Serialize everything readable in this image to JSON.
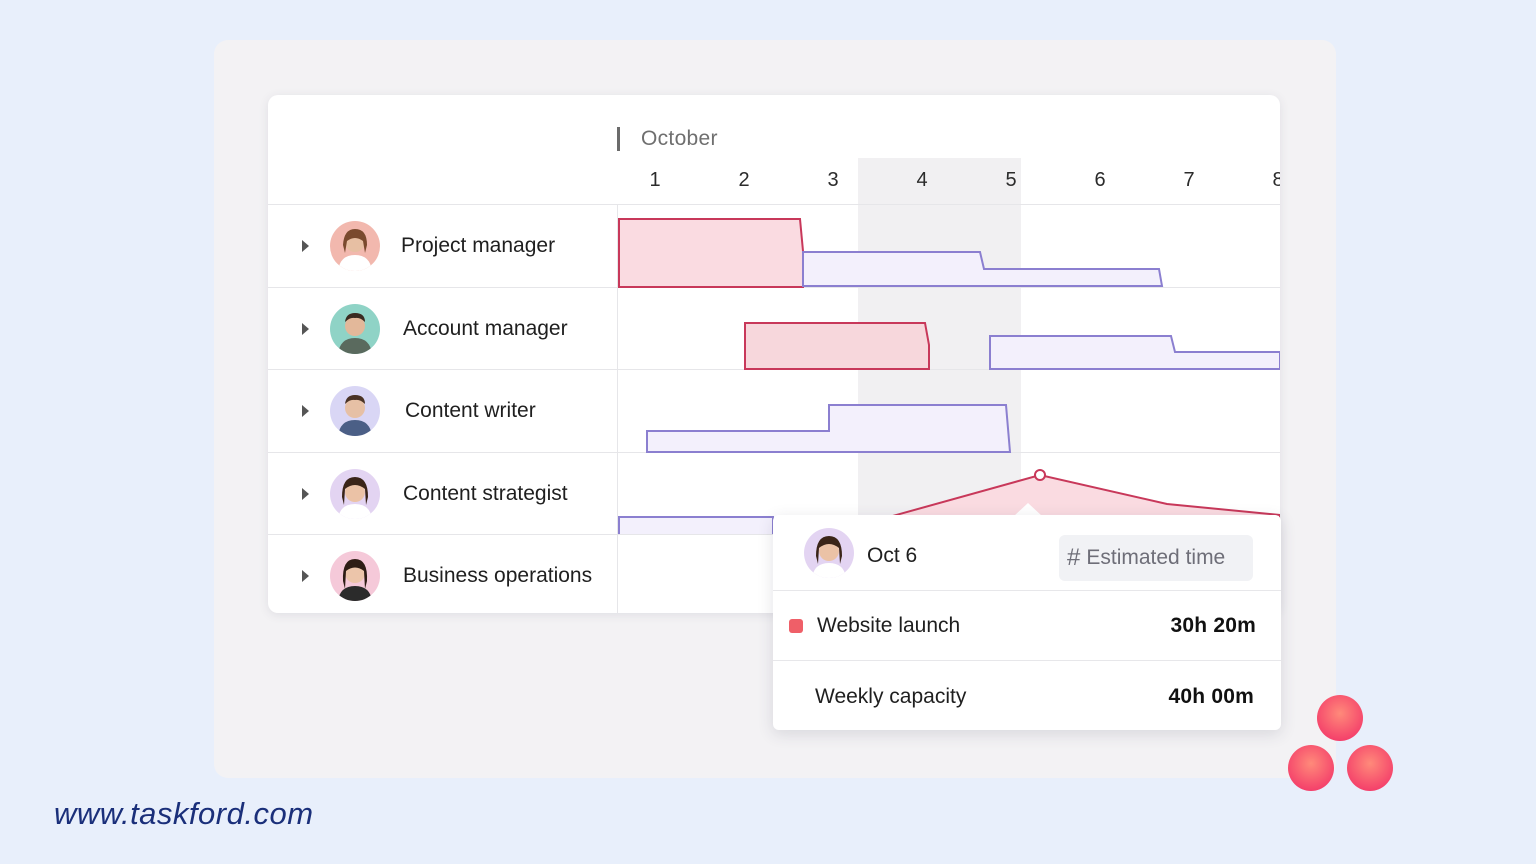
{
  "timeline": {
    "month": "October",
    "days": [
      "1",
      "2",
      "3",
      "4",
      "5",
      "6",
      "7",
      "8"
    ]
  },
  "rows": [
    {
      "role": "Project manager"
    },
    {
      "role": "Account manager"
    },
    {
      "role": "Content writer"
    },
    {
      "role": "Content strategist"
    },
    {
      "role": "Business operations"
    }
  ],
  "popover": {
    "date": "Oct 6",
    "chip_label": "Estimated time",
    "project": {
      "name": "Website launch",
      "value": "30h 20m",
      "color": "#ef5f68"
    },
    "capacity": {
      "name": "Weekly capacity",
      "value": "40h 00m"
    }
  },
  "footer": {
    "url": "www.taskford.com"
  },
  "colors": {
    "over": "#c8385a",
    "over_fill": "#fadbe1",
    "under": "#8b7fd0",
    "under_fill": "#f3f0fc",
    "logo": "#f5536a"
  }
}
